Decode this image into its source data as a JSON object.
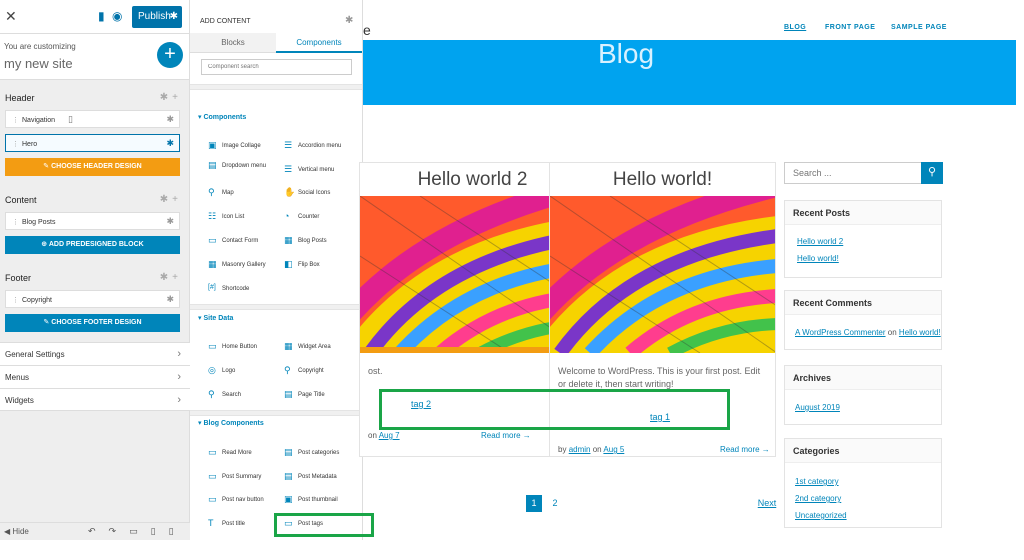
{
  "customizer": {
    "publish_label": "Publish",
    "you_are_customizing": "You are customizing",
    "site_name": "my new site",
    "sections": {
      "header": {
        "label": "Header",
        "items": [
          "Navigation",
          "Hero"
        ],
        "button": "CHOOSE HEADER DESIGN"
      },
      "content": {
        "label": "Content",
        "items": [
          "Blog Posts"
        ],
        "button": "ADD PREDESIGNED BLOCK"
      },
      "footer": {
        "label": "Footer",
        "items": [
          "Copyright"
        ],
        "button": "CHOOSE FOOTER DESIGN"
      }
    },
    "nav": [
      "General Settings",
      "Menus",
      "Widgets"
    ],
    "hide_label": "Hide"
  },
  "add_content": {
    "title": "ADD CONTENT",
    "tabs": [
      "Blocks",
      "Components"
    ],
    "search_placeholder": "Component search",
    "groups": {
      "components": {
        "label": "Components",
        "items": [
          "Image Collage",
          "Accordion menu",
          "Dropdown menu",
          "Vertical menu",
          "Map",
          "Social Icons",
          "Icon List",
          "Counter",
          "Contact Form",
          "Blog Posts",
          "Masonry Gallery",
          "Flip Box",
          "Shortcode"
        ]
      },
      "site_data": {
        "label": "Site Data",
        "items": [
          "Home Button",
          "Widget Area",
          "Logo",
          "Copyright",
          "Search",
          "Page Title"
        ]
      },
      "blog_components": {
        "label": "Blog Components",
        "items": [
          "Read More",
          "Post categories",
          "Post Summary",
          "Post Metadata",
          "Post nav button",
          "Post thumbnail",
          "Post title",
          "Post tags"
        ]
      }
    }
  },
  "site": {
    "brand_fragment": "e",
    "nav": [
      "BLOG",
      "FRONT PAGE",
      "SAMPLE PAGE"
    ],
    "banner_title": "Blog",
    "posts": [
      {
        "title": "Hello world 2",
        "excerpt": "ost.",
        "tag": "tag 2",
        "meta_prefix": "on",
        "date": "Aug 7",
        "read_more": "Read more →"
      },
      {
        "title": "Hello world!",
        "excerpt": "Welcome to WordPress. This is your first post. Edit or delete it, then start writing!",
        "tag": "tag 1",
        "meta_by": "by",
        "author": "admin",
        "meta_on": "on",
        "date": "Aug 5",
        "read_more": "Read more →"
      }
    ],
    "search_placeholder": "Search ...",
    "widgets": {
      "recent_posts": {
        "title": "Recent Posts",
        "links": [
          "Hello world 2",
          "Hello world!"
        ]
      },
      "recent_comments": {
        "title": "Recent Comments",
        "commenter": "A WordPress Commenter",
        "on": "on",
        "post": "Hello world!"
      },
      "archives": {
        "title": "Archives",
        "links": [
          "August 2019"
        ]
      },
      "categories": {
        "title": "Categories",
        "links": [
          "1st category",
          "2nd category",
          "Uncategorized"
        ]
      }
    },
    "pagination": {
      "pages": [
        "1",
        "2"
      ],
      "next": "Next"
    }
  },
  "colors": {
    "accent": "#0085ba",
    "banner": "#00a3ef",
    "orange": "#f39c12",
    "highlight": "#1aa547"
  }
}
